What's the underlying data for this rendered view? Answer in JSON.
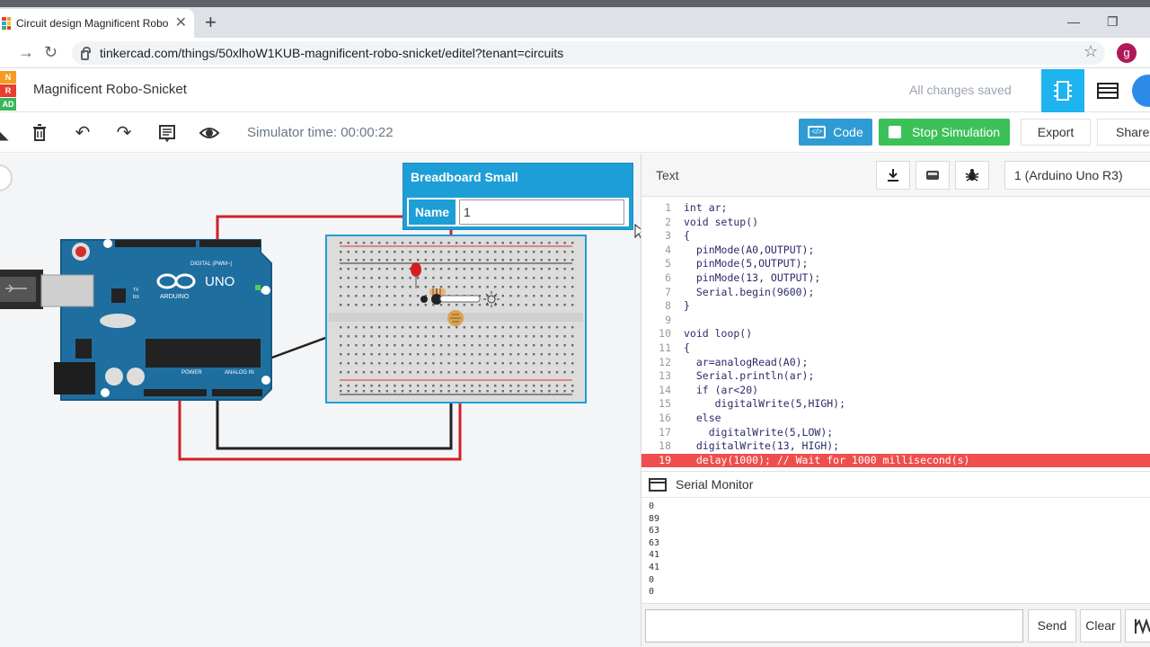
{
  "browser": {
    "tab_title": "Circuit design Magnificent Robo-",
    "tab_close": "✕",
    "new_tab": "+",
    "url": "tinkercad.com/things/50xlhoW1KUB-magnificent-robo-snicket/editel?tenant=circuits",
    "profile_initial": "g"
  },
  "logo": {
    "letters": [
      "N",
      "R",
      "AD"
    ]
  },
  "app": {
    "project_title": "Magnificent Robo-Snicket",
    "save_status": "All changes saved"
  },
  "toolbar": {
    "simulator_time": "Simulator time: 00:00:22",
    "code_label": "Code",
    "stop_label": "Stop Simulation",
    "export_label": "Export",
    "share_label": "Share"
  },
  "inspector": {
    "component": "Breadboard Small",
    "name_label": "Name",
    "name_value": "1"
  },
  "circuit_labels": {
    "brand": "ARDUINO",
    "model": "UNO",
    "digital": "DIGITAL (PWM~)",
    "power": "POWER",
    "analog": "ANALOG IN",
    "on": "ON",
    "tx": "TX",
    "rx": "RX"
  },
  "code_panel": {
    "mode": "Text",
    "device": "1 (Arduino Uno R3)",
    "icons": [
      "download-icon",
      "library-icon",
      "debug-icon"
    ]
  },
  "code_lines": [
    {
      "n": "1",
      "text": "int ar;"
    },
    {
      "n": "2",
      "text": "void setup()"
    },
    {
      "n": "3",
      "text": "{"
    },
    {
      "n": "4",
      "text": "  pinMode(A0,OUTPUT);"
    },
    {
      "n": "5",
      "text": "  pinMode(5,OUTPUT);"
    },
    {
      "n": "6",
      "text": "  pinMode(13, OUTPUT);"
    },
    {
      "n": "7",
      "text": "  Serial.begin(9600);"
    },
    {
      "n": "8",
      "text": "}"
    },
    {
      "n": "9",
      "text": ""
    },
    {
      "n": "10",
      "text": "void loop()"
    },
    {
      "n": "11",
      "text": "{"
    },
    {
      "n": "12",
      "text": "  ar=analogRead(A0);"
    },
    {
      "n": "13",
      "text": "  Serial.println(ar);"
    },
    {
      "n": "14",
      "text": "  if (ar<20)"
    },
    {
      "n": "15",
      "text": "     digitalWrite(5,HIGH);"
    },
    {
      "n": "16",
      "text": "  else"
    },
    {
      "n": "17",
      "text": "    digitalWrite(5,LOW);"
    },
    {
      "n": "18",
      "text": "  digitalWrite(13, HIGH);"
    },
    {
      "n": "19",
      "text": "  delay(1000); // Wait for 1000 millisecond(s)",
      "highlight": true
    }
  ],
  "serial": {
    "title": "Serial Monitor",
    "output": [
      "0",
      "89",
      "63",
      "63",
      "41",
      "41",
      "0",
      "0"
    ],
    "send_label": "Send",
    "clear_label": "Clear"
  },
  "colors": {
    "accent_blue": "#1e9ed6",
    "stop_green": "#3cc159",
    "error_red": "#f04e4e",
    "wire_red": "#d0202a",
    "wire_black": "#222222"
  }
}
